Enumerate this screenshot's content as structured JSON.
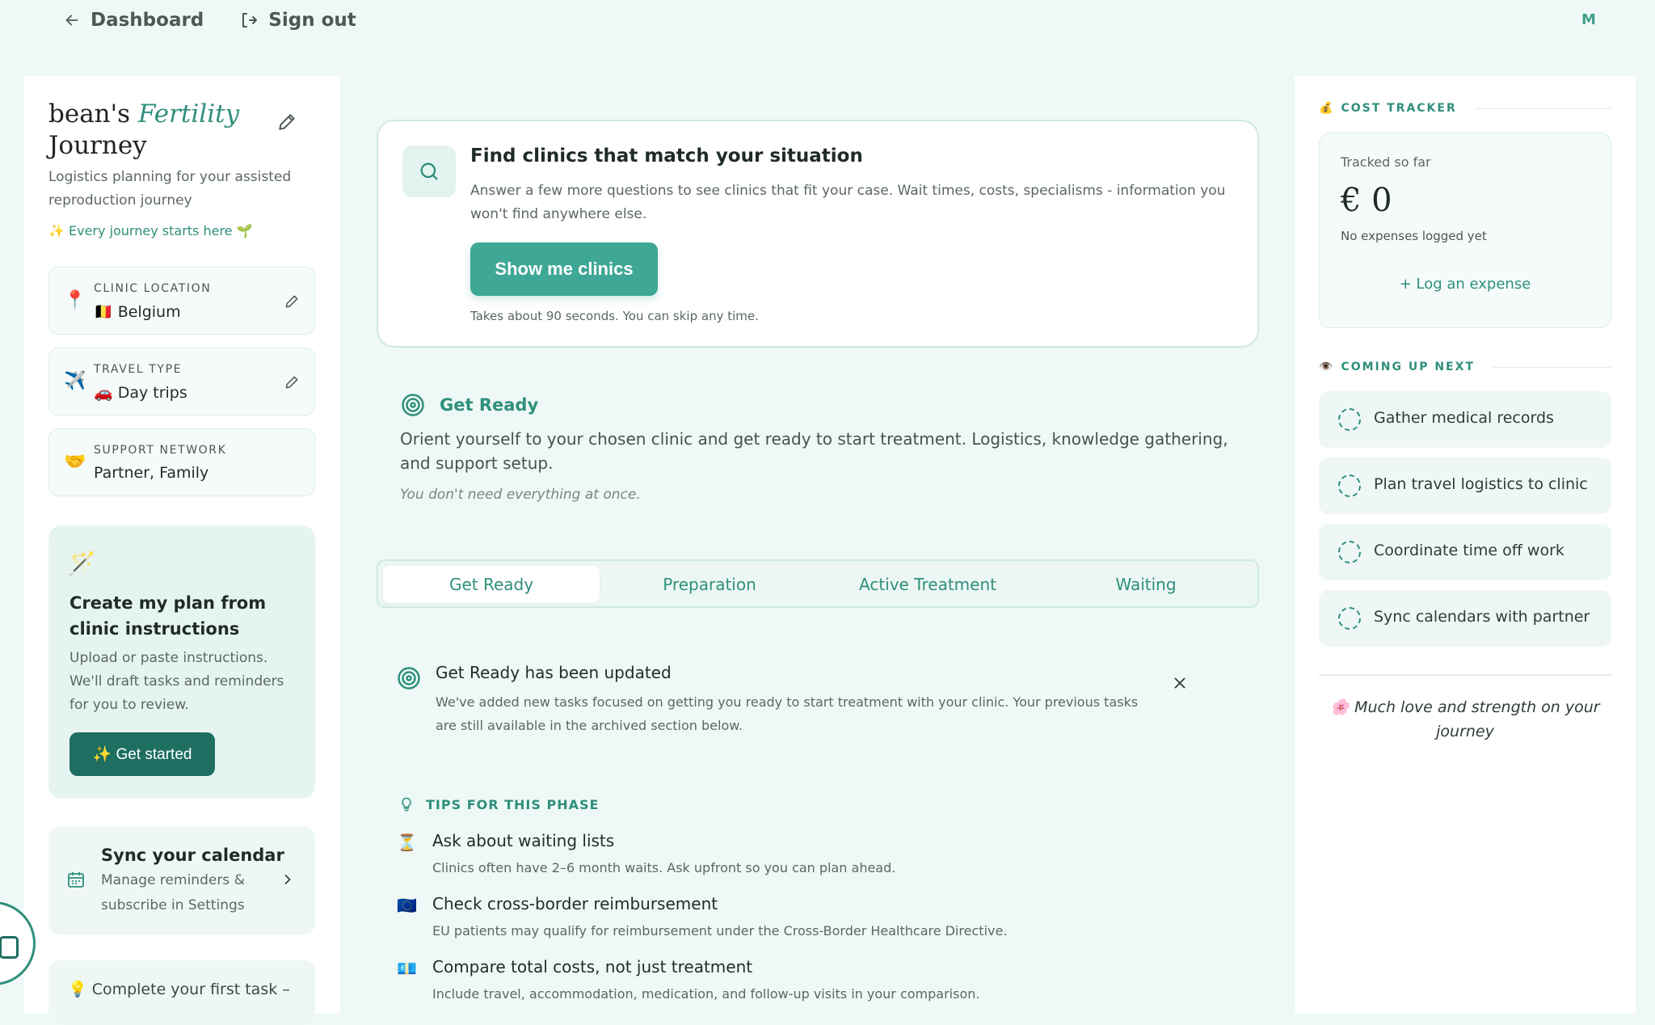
{
  "topbar": {
    "dashboard_label": "Dashboard",
    "signout_label": "Sign out",
    "avatar_initial": "M"
  },
  "sidebar": {
    "title_prefix": "bean's",
    "title_italic": "Fertility",
    "title_suffix": "Journey",
    "subtitle": "Logistics planning for your assisted reproduction journey",
    "tagline": "✨ Every journey starts here 🌱",
    "info_cards": [
      {
        "label": "CLINIC LOCATION",
        "value": "🇧🇪 Belgium",
        "icon": "📍"
      },
      {
        "label": "TRAVEL TYPE",
        "value": "🚗 Day trips",
        "icon": "✈️"
      },
      {
        "label": "SUPPORT NETWORK",
        "value": "Partner, Family",
        "icon": "🤝"
      }
    ],
    "plan_card": {
      "title": "Create my plan from clinic instructions",
      "body": "Upload or paste instructions. We'll draft tasks and reminders for you to review.",
      "button": "✨ Get started"
    },
    "sync_card": {
      "title": "Sync your calendar",
      "body": "Manage reminders & subscribe in Settings"
    },
    "task_card": {
      "text": "💡 Complete your first task –"
    }
  },
  "main": {
    "find_card": {
      "title": "Find clinics that match your situation",
      "body": "Answer a few more questions to see clinics that fit your case. Wait times, costs, specialisms - information you won't find anywhere else.",
      "button": "Show me clinics",
      "note": "Takes about 90 seconds. You can skip any time."
    },
    "phase": {
      "title": "Get Ready",
      "description": "Orient yourself to your chosen clinic and get ready to start treatment. Logistics, knowledge gathering, and support setup.",
      "note": "You don't need everything at once."
    },
    "tabs": [
      {
        "label": "Get Ready",
        "active": true
      },
      {
        "label": "Preparation",
        "active": false
      },
      {
        "label": "Active Treatment",
        "active": false
      },
      {
        "label": "Waiting",
        "active": false
      }
    ],
    "update": {
      "title": "Get Ready has been updated",
      "body": "We've added new tasks focused on getting you ready to start treatment with your clinic. Your previous tasks are still available in the archived section below."
    },
    "tips": {
      "heading": "TIPS FOR THIS PHASE",
      "items": [
        {
          "emoji": "⏳",
          "title": "Ask about waiting lists",
          "body": "Clinics often have 2–6 month waits. Ask upfront so you can plan ahead."
        },
        {
          "emoji": "🇪🇺",
          "title": "Check cross-border reimbursement",
          "body": "EU patients may qualify for reimbursement under the Cross-Border Healthcare Directive."
        },
        {
          "emoji": "💶",
          "title": "Compare total costs, not just treatment",
          "body": "Include travel, accommodation, medication, and follow-up visits in your comparison."
        }
      ]
    }
  },
  "right": {
    "cost_heading": "COST TRACKER",
    "cost_icon": "💰",
    "tracked_label": "Tracked so far",
    "amount": "€ 0",
    "none_label": "No expenses logged yet",
    "log_button": "+ Log an expense",
    "next_heading": "COMING UP NEXT",
    "next_icon": "👁️",
    "next_items": [
      "Gather medical records",
      "Plan travel logistics to clinic",
      "Coordinate time off work",
      "Sync calendars with partner"
    ],
    "love_text": "🌸 Much love and strength on your journey"
  },
  "colors": {
    "accent": "#2f8f7c",
    "button_teal": "#3fa796",
    "button_dark": "#1e6e62",
    "background": "#eef8f6"
  }
}
